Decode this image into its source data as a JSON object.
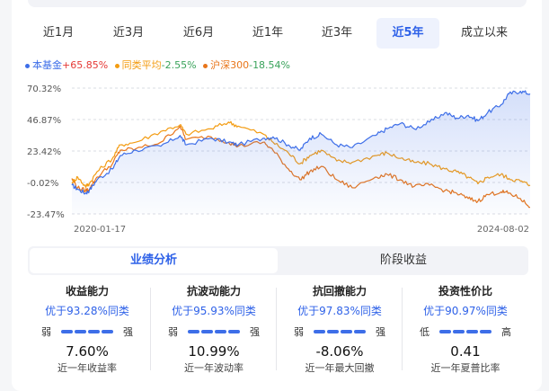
{
  "period_tabs": [
    {
      "label": "近1月",
      "active": false
    },
    {
      "label": "近3月",
      "active": false
    },
    {
      "label": "近6月",
      "active": false
    },
    {
      "label": "近1年",
      "active": false
    },
    {
      "label": "近3年",
      "active": false
    },
    {
      "label": "近5年",
      "active": true
    },
    {
      "label": "成立以来",
      "active": false
    }
  ],
  "legend": [
    {
      "name": "本基金",
      "value": "+65.85%",
      "color": "#3d6ee8",
      "value_color": "#e53935"
    },
    {
      "name": "同类平均",
      "value": "-2.55%",
      "color": "#f39c12",
      "value_color": "#3aa35b"
    },
    {
      "name": "沪深300",
      "value": "-18.54%",
      "color": "#e8751a",
      "value_color": "#3aa35b"
    }
  ],
  "chart_data": {
    "type": "line",
    "y_ticks": [
      "70.32%",
      "46.87%",
      "23.42%",
      "-0.02%",
      "-23.47%"
    ],
    "ylim": [
      -23.47,
      70.32
    ],
    "x_labels": [
      "2020-01-17",
      "2024-08-02"
    ],
    "xlim": [
      "2020-01-17",
      "2024-08-02"
    ],
    "grid": "horizontal-dashed",
    "series": [
      {
        "name": "本基金",
        "color": "#3d6ee8",
        "area_fill": true,
        "x": [
          "2020-01-17",
          "2020-02-07",
          "2020-03-06",
          "2020-03-20",
          "2020-04-17",
          "2020-06-12",
          "2020-07-10",
          "2020-09-04",
          "2020-12-04",
          "2021-02-12",
          "2021-03-05",
          "2021-06-04",
          "2021-08-06",
          "2021-09-10",
          "2021-12-10",
          "2022-01-14",
          "2022-03-11",
          "2022-04-22",
          "2022-05-27",
          "2022-07-08",
          "2022-09-02",
          "2022-10-28",
          "2023-01-20",
          "2023-03-03",
          "2023-04-21",
          "2023-06-09",
          "2023-08-04",
          "2023-09-29",
          "2023-11-10",
          "2023-12-22",
          "2024-01-26",
          "2024-03-01",
          "2024-04-19",
          "2024-05-17",
          "2024-06-28",
          "2024-08-02"
        ],
        "y": [
          -2,
          -5,
          -8,
          -6,
          2,
          10,
          20,
          24,
          27,
          35,
          28,
          33,
          30,
          28,
          33,
          34,
          28,
          24,
          33,
          36,
          28,
          26,
          35,
          40,
          44,
          40,
          45,
          52,
          48,
          50,
          46,
          52,
          58,
          66,
          68,
          66
        ]
      },
      {
        "name": "同类平均",
        "color": "#f39c12",
        "area_fill": false,
        "x": [
          "2020-01-17",
          "2020-02-07",
          "2020-03-06",
          "2020-03-20",
          "2020-04-17",
          "2020-06-12",
          "2020-07-10",
          "2020-09-04",
          "2020-12-04",
          "2021-02-12",
          "2021-03-05",
          "2021-06-04",
          "2021-08-06",
          "2021-09-10",
          "2021-12-10",
          "2022-01-14",
          "2022-03-11",
          "2022-04-22",
          "2022-05-27",
          "2022-07-08",
          "2022-09-02",
          "2022-10-28",
          "2023-01-20",
          "2023-03-03",
          "2023-04-21",
          "2023-06-09",
          "2023-08-04",
          "2023-09-29",
          "2023-11-10",
          "2023-12-22",
          "2024-01-26",
          "2024-03-01",
          "2024-04-19",
          "2024-05-17",
          "2024-06-28",
          "2024-08-02"
        ],
        "y": [
          0,
          4,
          -3,
          -1,
          8,
          18,
          28,
          30,
          38,
          43,
          36,
          40,
          45,
          42,
          36,
          30,
          22,
          14,
          20,
          24,
          16,
          15,
          20,
          22,
          18,
          15,
          14,
          10,
          8,
          4,
          -1,
          4,
          6,
          3,
          1,
          -2
        ]
      },
      {
        "name": "沪深300",
        "color": "#e8751a",
        "area_fill": false,
        "x": [
          "2020-01-17",
          "2020-02-07",
          "2020-03-06",
          "2020-03-20",
          "2020-04-17",
          "2020-06-12",
          "2020-07-10",
          "2020-09-04",
          "2020-12-04",
          "2021-02-12",
          "2021-03-05",
          "2021-06-04",
          "2021-08-06",
          "2021-09-10",
          "2021-12-10",
          "2022-01-14",
          "2022-03-11",
          "2022-04-22",
          "2022-05-27",
          "2022-07-08",
          "2022-09-02",
          "2022-10-28",
          "2023-01-20",
          "2023-03-03",
          "2023-04-21",
          "2023-06-09",
          "2023-08-04",
          "2023-09-29",
          "2023-11-10",
          "2023-12-22",
          "2024-01-26",
          "2024-03-01",
          "2024-04-19",
          "2024-05-17",
          "2024-06-28",
          "2024-08-02"
        ],
        "y": [
          3,
          -4,
          -6,
          -5,
          4,
          14,
          24,
          25,
          30,
          42,
          32,
          34,
          30,
          27,
          30,
          24,
          10,
          2,
          8,
          12,
          2,
          -4,
          4,
          6,
          2,
          -3,
          -2,
          -6,
          -8,
          -12,
          -14,
          -9,
          -7,
          -8,
          -12,
          -18.5
        ]
      }
    ]
  },
  "section_tabs": [
    {
      "label": "业绩分析",
      "active": true
    },
    {
      "label": "阶段收益",
      "active": false
    }
  ],
  "metrics": [
    {
      "title": "收益能力",
      "rank": "优于93.28%同类",
      "low": "弱",
      "high": "强",
      "level": 0.93,
      "value": "7.60%",
      "desc": "近一年收益率"
    },
    {
      "title": "抗波动能力",
      "rank": "优于95.93%同类",
      "low": "弱",
      "high": "强",
      "level": 0.96,
      "value": "10.99%",
      "desc": "近一年波动率"
    },
    {
      "title": "抗回撤能力",
      "rank": "优于97.83%同类",
      "low": "弱",
      "high": "强",
      "level": 0.98,
      "value": "-8.06%",
      "desc": "近一年最大回撤"
    },
    {
      "title": "投资性价比",
      "rank": "优于90.97%同类",
      "low": "低",
      "high": "高",
      "level": 0.91,
      "value": "0.41",
      "desc": "近一年夏普比率"
    }
  ]
}
